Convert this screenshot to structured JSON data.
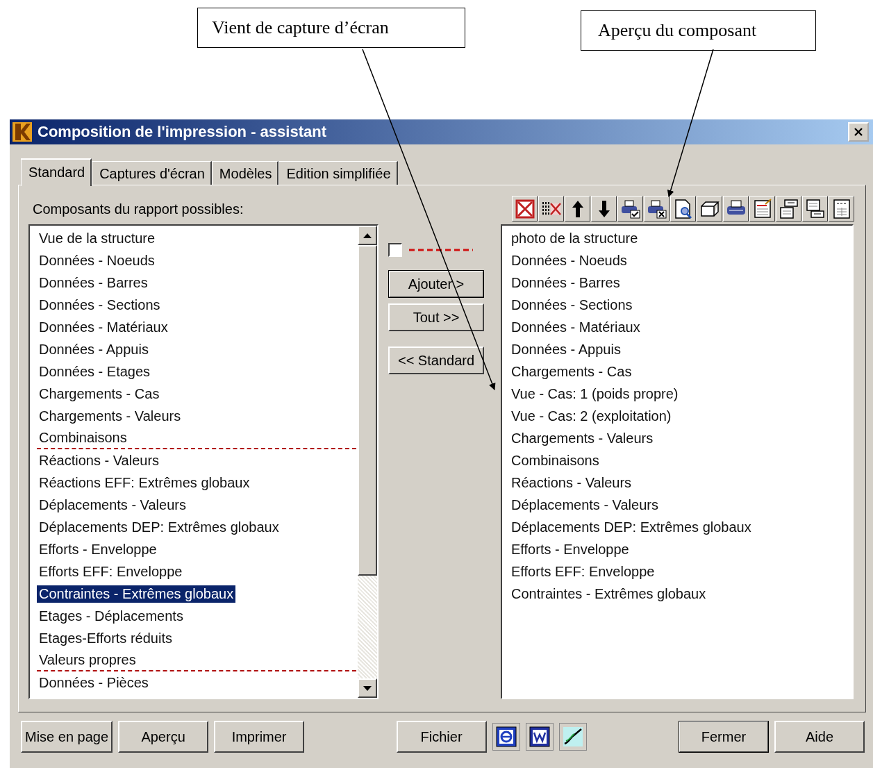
{
  "callouts": [
    {
      "text": "Vient de capture d’écran"
    },
    {
      "text": "Aperçu du composant"
    }
  ],
  "window": {
    "title": "Composition de l'impression - assistant"
  },
  "tabs": [
    {
      "label": "Standard",
      "selected": true
    },
    {
      "label": "Captures d'écran",
      "selected": false
    },
    {
      "label": "Modèles",
      "selected": false
    },
    {
      "label": "Edition simplifiée",
      "selected": false
    }
  ],
  "available": {
    "label": "Composants du rapport possibles:",
    "items": [
      {
        "label": "Vue de la structure",
        "selected": false,
        "separator_after": false
      },
      {
        "label": "Données - Noeuds",
        "selected": false,
        "separator_after": false
      },
      {
        "label": "Données - Barres",
        "selected": false,
        "separator_after": false
      },
      {
        "label": "Données - Sections",
        "selected": false,
        "separator_after": false
      },
      {
        "label": "Données - Matériaux",
        "selected": false,
        "separator_after": false
      },
      {
        "label": "Données - Appuis",
        "selected": false,
        "separator_after": false
      },
      {
        "label": "Données - Etages",
        "selected": false,
        "separator_after": false
      },
      {
        "label": "Chargements - Cas",
        "selected": false,
        "separator_after": false
      },
      {
        "label": "Chargements - Valeurs",
        "selected": false,
        "separator_after": false
      },
      {
        "label": "Combinaisons",
        "selected": false,
        "separator_after": true
      },
      {
        "label": "Réactions - Valeurs",
        "selected": false,
        "separator_after": false
      },
      {
        "label": "Réactions EFF: Extrêmes globaux",
        "selected": false,
        "separator_after": false
      },
      {
        "label": "Déplacements - Valeurs",
        "selected": false,
        "separator_after": false
      },
      {
        "label": "Déplacements DEP: Extrêmes globaux",
        "selected": false,
        "separator_after": false
      },
      {
        "label": "Efforts - Enveloppe",
        "selected": false,
        "separator_after": false
      },
      {
        "label": "Efforts EFF: Enveloppe",
        "selected": false,
        "separator_after": false
      },
      {
        "label": "Contraintes - Extrêmes globaux",
        "selected": true,
        "separator_after": false
      },
      {
        "label": "Etages - Déplacements",
        "selected": false,
        "separator_after": false
      },
      {
        "label": "Etages-Efforts réduits",
        "selected": false,
        "separator_after": false
      },
      {
        "label": "Valeurs propres",
        "selected": false,
        "separator_after": true
      },
      {
        "label": "Données - Pièces",
        "selected": false,
        "separator_after": false
      }
    ]
  },
  "separator_checkbox": {
    "checked": false
  },
  "middle_buttons": [
    {
      "label": "Ajouter >",
      "default": true
    },
    {
      "label": "Tout >>",
      "default": false
    },
    {
      "label": "<< Standard",
      "default": false
    }
  ],
  "report": {
    "items": [
      {
        "label": "photo de la structure"
      },
      {
        "label": "Données - Noeuds"
      },
      {
        "label": "Données - Barres"
      },
      {
        "label": "Données - Sections"
      },
      {
        "label": "Données - Matériaux"
      },
      {
        "label": "Données - Appuis"
      },
      {
        "label": "Chargements - Cas"
      },
      {
        "label": "Vue - Cas: 1 (poids propre)"
      },
      {
        "label": "Vue - Cas: 2 (exploitation)"
      },
      {
        "label": "Chargements - Valeurs"
      },
      {
        "label": "Combinaisons"
      },
      {
        "label": "Réactions - Valeurs"
      },
      {
        "label": "Déplacements - Valeurs"
      },
      {
        "label": "Déplacements DEP: Extrêmes globaux"
      },
      {
        "label": "Efforts - Enveloppe"
      },
      {
        "label": "Efforts EFF: Enveloppe"
      },
      {
        "label": "Contraintes - Extrêmes globaux"
      }
    ]
  },
  "bottom_buttons": [
    {
      "kind": "text",
      "label": "Mise en page",
      "default": false
    },
    {
      "kind": "text",
      "label": "Aperçu",
      "default": false
    },
    {
      "kind": "text",
      "label": "Imprimer",
      "default": false
    },
    {
      "kind": "gap"
    },
    {
      "kind": "text",
      "label": "Fichier",
      "default": false
    },
    {
      "kind": "browser"
    },
    {
      "kind": "document"
    },
    {
      "kind": "chart"
    },
    {
      "kind": "gap"
    },
    {
      "kind": "text",
      "label": "Fermer",
      "default": true
    },
    {
      "kind": "text",
      "label": "Aide",
      "default": false
    }
  ]
}
